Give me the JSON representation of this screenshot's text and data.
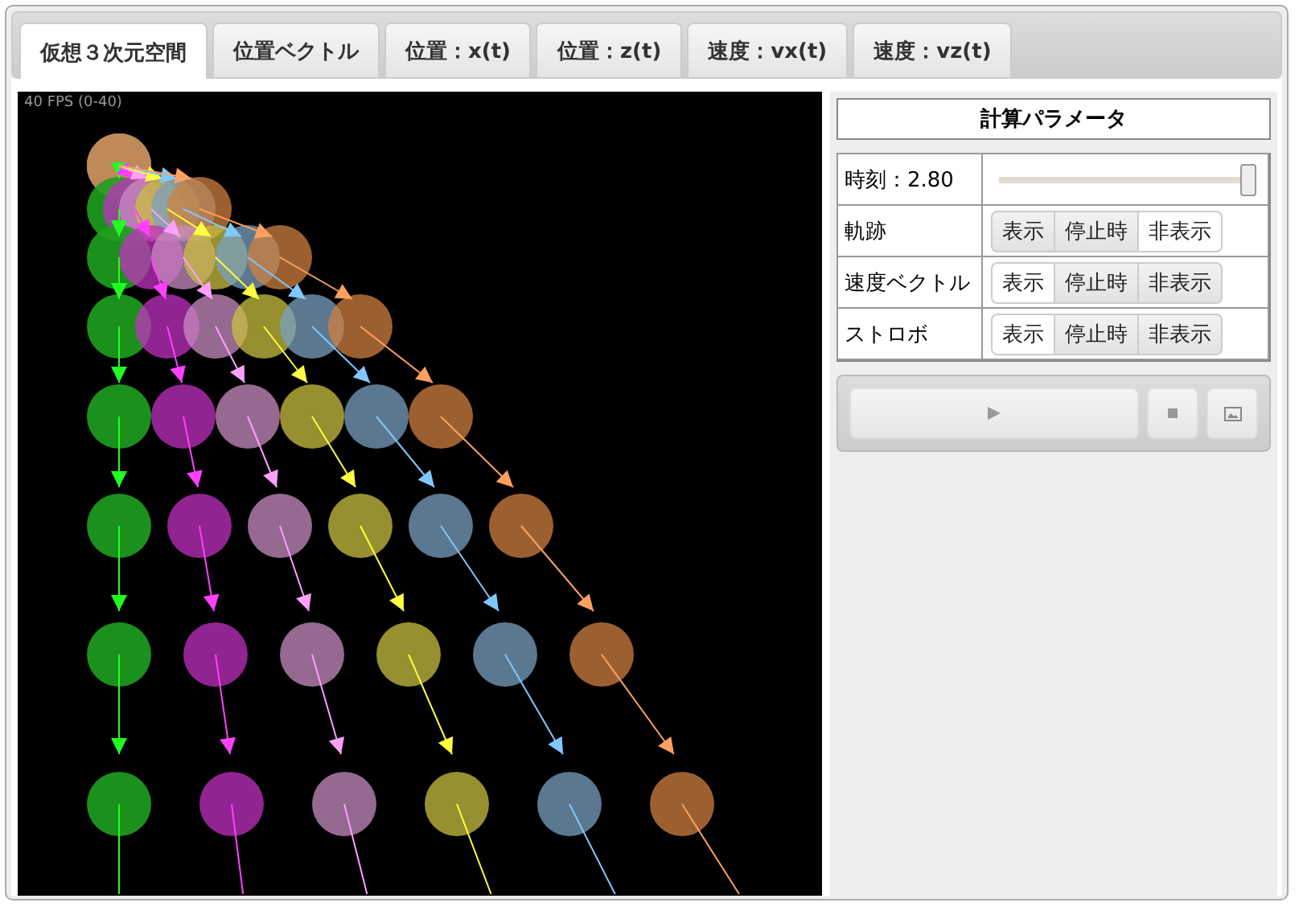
{
  "tabs": [
    {
      "label": "仮想３次元空間",
      "selected": true
    },
    {
      "label": "位置ベクトル",
      "selected": false
    },
    {
      "label": "位置：x(t)",
      "selected": false
    },
    {
      "label": "位置：z(t)",
      "selected": false
    },
    {
      "label": "速度：vx(t)",
      "selected": false
    },
    {
      "label": "速度：vz(t)",
      "selected": false
    }
  ],
  "viewport": {
    "fps_label": "40 FPS (0-40)"
  },
  "panel": {
    "title": "計算パラメータ",
    "time": {
      "label": "時刻：2.80",
      "level": 1
    },
    "toggles": [
      {
        "label": "軌跡",
        "options": [
          {
            "label": "表示",
            "selected": false
          },
          {
            "label": "停止時",
            "selected": false
          },
          {
            "label": "非表示",
            "selected": true
          }
        ]
      },
      {
        "label": "速度ベクトル",
        "options": [
          {
            "label": "表示",
            "selected": true
          },
          {
            "label": "停止時",
            "selected": false
          },
          {
            "label": "非表示",
            "selected": false
          }
        ]
      },
      {
        "label": "ストロボ",
        "options": [
          {
            "label": "表示",
            "selected": true
          },
          {
            "label": "停止時",
            "selected": false
          },
          {
            "label": "非表示",
            "selected": false
          }
        ]
      }
    ]
  }
}
